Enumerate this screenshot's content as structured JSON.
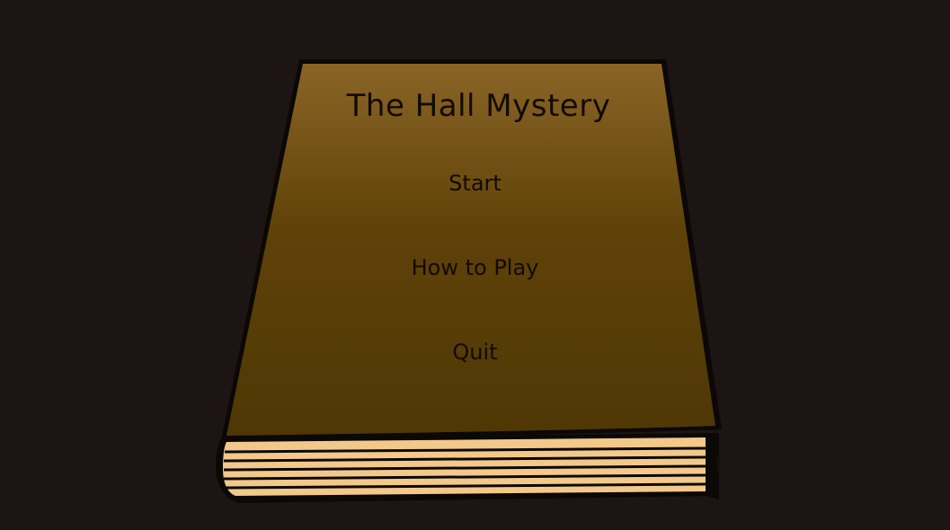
{
  "game": {
    "title": "The Hall Mystery"
  },
  "menu": {
    "start_label": "Start",
    "how_to_play_label": "How to Play",
    "quit_label": "Quit"
  },
  "colors": {
    "background": "#1d1513",
    "cover_top": "#8a6426",
    "cover_bottom": "#4f3705",
    "pages": "#f2c98a",
    "outline": "#0b0806"
  }
}
